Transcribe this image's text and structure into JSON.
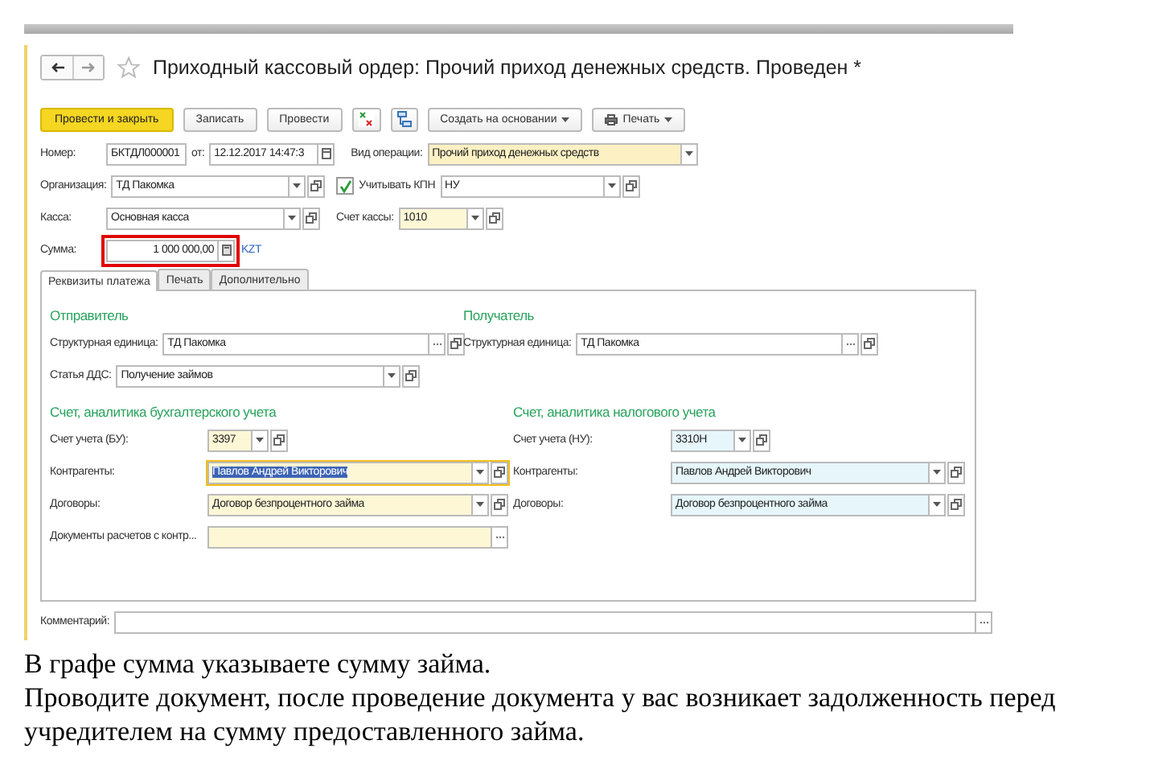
{
  "window": {
    "title": "Приходный кассовый ордер: Прочий приход денежных средств. Проведен *"
  },
  "toolbar": [
    {
      "kind": "primary",
      "label": "Провести и закрыть"
    },
    {
      "kind": "plain",
      "label": "Записать"
    },
    {
      "kind": "plain",
      "label": "Провести"
    },
    {
      "kind": "ledger"
    },
    {
      "kind": "tree"
    },
    {
      "kind": "menu",
      "label": "Создать на основании"
    },
    {
      "kind": "print",
      "label": "Печать"
    }
  ],
  "header": {
    "number": {
      "label": "Номер:",
      "value": "БКТДЛ000001"
    },
    "date": {
      "label": "от:",
      "value": "12.12.2017 14:47:3",
      "kind": "date"
    },
    "operation": {
      "label": "Вид операции:",
      "value": "Прочий приход денежных средств",
      "kind": "select",
      "color": "#fdf1c4"
    },
    "organization": {
      "label": "Организация:",
      "value": "ТД Пакомка",
      "kind": "reference"
    },
    "kpn": {
      "label": "Учитывать КПН",
      "checked": true,
      "value": "НУ",
      "kind": "reference"
    },
    "cash_desk": {
      "label": "Касса:",
      "value": "Основная касса",
      "kind": "reference"
    },
    "cash_account": {
      "label": "Счет кассы:",
      "value": "1010",
      "kind": "reference",
      "color": "#fdf7d6"
    },
    "amount": {
      "label": "Сумма:",
      "value": "1 000 000,00",
      "kind": "number",
      "currency": "KZT",
      "highlighted": true
    }
  },
  "tabs": [
    {
      "label": "Реквизиты платежа",
      "selected": true
    },
    {
      "label": "Печать",
      "selected": false
    },
    {
      "label": "Дополнительно",
      "selected": false
    }
  ],
  "sender": {
    "heading": "Отправитель",
    "fields": [
      {
        "label": "Структурная единица:",
        "value": "ТД Пакомка",
        "kind": "picker"
      },
      {
        "label": "Статья ДДС:",
        "value": "Получение займов",
        "kind": "reference"
      }
    ]
  },
  "receiver": {
    "heading": "Получатель",
    "fields": [
      {
        "label": "Структурная единица:",
        "value": "ТД Пакомка",
        "kind": "picker"
      }
    ]
  },
  "accounting": {
    "heading": "Счет, аналитика бухгалтерского учета",
    "fields": [
      {
        "label": "Счет учета (БУ):",
        "value": "3397",
        "kind": "reference",
        "color": "#fdf7d6",
        "focused": false,
        "text_selected": false
      },
      {
        "label": "Контрагенты:",
        "value": "Павлов Андрей Викторович",
        "kind": "reference",
        "color": "#fdf7d6",
        "focused": true,
        "text_selected": true
      },
      {
        "label": "Договоры:",
        "value": "Договор безпроцентного займа",
        "kind": "reference",
        "color": "#fdf7d6",
        "focused": false,
        "text_selected": false
      },
      {
        "label": "Документы расчетов с контр...",
        "kind": "choice",
        "color": "#fdf7d6",
        "focused": false
      }
    ]
  },
  "tax": {
    "heading": "Счет, аналитика налогового учета",
    "fields": [
      {
        "label": "Счет учета (НУ):",
        "value": "3310Н",
        "kind": "reference",
        "color": "#e6f6fb",
        "focused": false,
        "text_selected": false
      },
      {
        "label": "Контрагенты:",
        "value": "Павлов Андрей Викторович",
        "kind": "reference",
        "color": "#e6f6fb",
        "focused": false,
        "text_selected": false
      },
      {
        "label": "Договоры:",
        "value": "Договор безпроцентного займа",
        "kind": "reference",
        "color": "#e6f6fb",
        "focused": false,
        "text_selected": false
      }
    ]
  },
  "comment": {
    "label": "Комментарий:",
    "kind": "choice"
  },
  "caption": [
    "В графе сумма указываете сумму займа.",
    "Проводите документ, после проведение документа у вас возникает задолженность перед учредителем на сумму предоставленного займа."
  ]
}
